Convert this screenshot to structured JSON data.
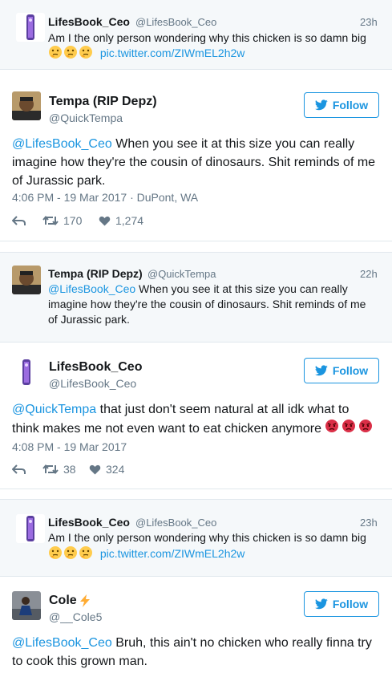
{
  "quote1": {
    "name": "LifesBook_Ceo",
    "handle": "@LifesBook_Ceo",
    "time": "23h",
    "text": "Am I the only person wondering why this chicken is so damn big",
    "link": "pic.twitter.com/ZIWmEL2h2w"
  },
  "tweet1": {
    "name": "Tempa (RIP Depz)",
    "handle": "@QuickTempa",
    "follow_label": "Follow",
    "mention": "@LifesBook_Ceo",
    "text_a": " When you see it at this size you can really",
    "text_b": "imagine how they're the cousin of dinosaurs. Shit reminds of me",
    "text_c": "of Jurassic park.",
    "meta": "4:06 PM - 19 Mar 2017 · DuPont, WA",
    "retweets": "170",
    "likes": "1,274"
  },
  "quote2": {
    "name": "Tempa (RIP Depz)",
    "handle": "@QuickTempa",
    "time": "22h",
    "mention": "@LifesBook_Ceo",
    "text_a": " When you see it at this size you can really",
    "text_b": "imagine how they're the cousin of dinosaurs. Shit reminds of me",
    "text_c": "of Jurassic park."
  },
  "tweet2": {
    "name": "LifesBook_Ceo",
    "handle": "@LifesBook_Ceo",
    "follow_label": "Follow",
    "mention": "@QuickTempa",
    "text_a": " that just don't seem natural at all idk what to",
    "text_b": "think makes me not even want to eat chicken anymore",
    "meta": "4:08 PM - 19 Mar 2017",
    "retweets": "38",
    "likes": "324"
  },
  "quote3": {
    "name": "LifesBook_Ceo",
    "handle": "@LifesBook_Ceo",
    "time": "23h",
    "text": "Am I the only person wondering why this chicken is so damn big",
    "link": "pic.twitter.com/ZIWmEL2h2w"
  },
  "tweet3": {
    "name": "Cole",
    "handle": "@__Cole5",
    "follow_label": "Follow",
    "mention": "@LifesBook_Ceo",
    "text_a": " Bruh, this ain't no chicken who really finna try",
    "text_b": "to cook this grown man."
  },
  "colors": {
    "link": "#1b95e0",
    "muted": "#657786",
    "band": "#f5f8fa"
  },
  "icons": [
    "reply-icon",
    "retweet-icon",
    "heart-icon",
    "twitter-bird-icon",
    "thinking-emoji",
    "angry-emoji",
    "lightning-emoji"
  ]
}
